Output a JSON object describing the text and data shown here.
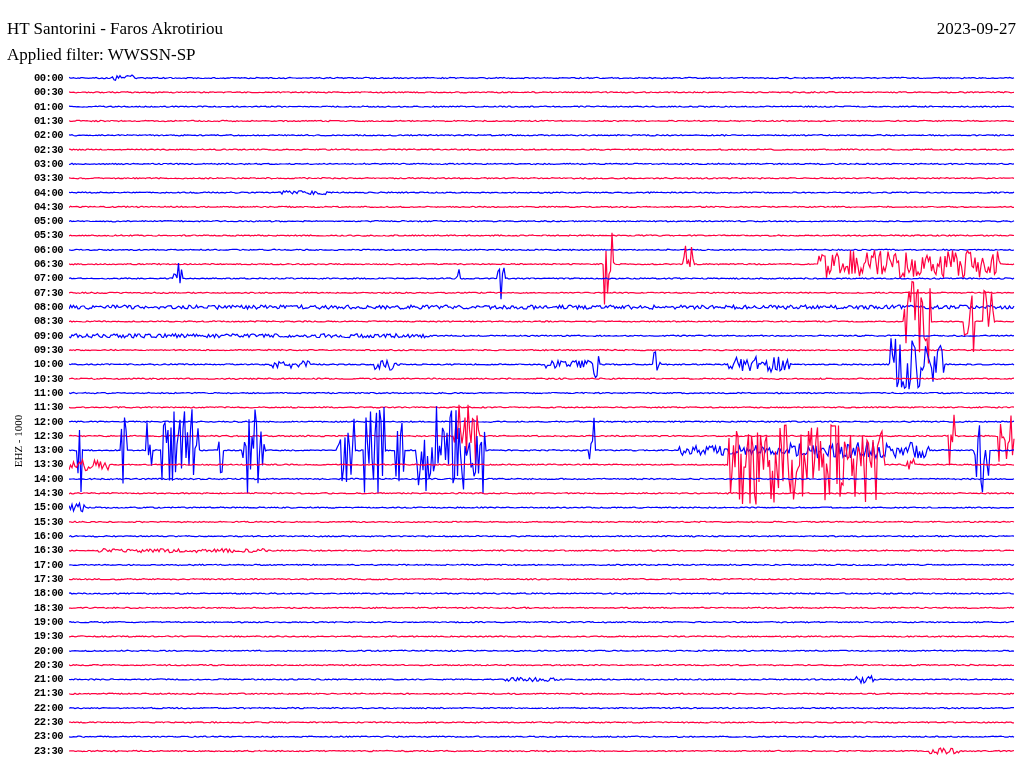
{
  "header": {
    "title": "HT Santorini - Faros Akrotiriou",
    "date": "2023-09-27",
    "filter": "Applied filter: WWSSN-SP"
  },
  "helicorder": {
    "channel_label": "EHZ - 1000",
    "rows": [
      {
        "time": "00:00",
        "color": "#0000ff"
      },
      {
        "time": "00:30",
        "color": "#ff0040"
      },
      {
        "time": "01:00",
        "color": "#0000ff"
      },
      {
        "time": "01:30",
        "color": "#ff0040"
      },
      {
        "time": "02:00",
        "color": "#0000ff"
      },
      {
        "time": "02:30",
        "color": "#ff0040"
      },
      {
        "time": "03:00",
        "color": "#0000ff"
      },
      {
        "time": "03:30",
        "color": "#ff0040"
      },
      {
        "time": "04:00",
        "color": "#0000ff"
      },
      {
        "time": "04:30",
        "color": "#ff0040"
      },
      {
        "time": "05:00",
        "color": "#0000ff"
      },
      {
        "time": "05:30",
        "color": "#ff0040"
      },
      {
        "time": "06:00",
        "color": "#0000ff"
      },
      {
        "time": "06:30",
        "color": "#ff0040"
      },
      {
        "time": "07:00",
        "color": "#0000ff"
      },
      {
        "time": "07:30",
        "color": "#ff0040"
      },
      {
        "time": "08:00",
        "color": "#0000ff"
      },
      {
        "time": "08:30",
        "color": "#ff0040"
      },
      {
        "time": "09:00",
        "color": "#0000ff"
      },
      {
        "time": "09:30",
        "color": "#ff0040"
      },
      {
        "time": "10:00",
        "color": "#0000ff"
      },
      {
        "time": "10:30",
        "color": "#ff0040"
      },
      {
        "time": "11:00",
        "color": "#0000ff"
      },
      {
        "time": "11:30",
        "color": "#ff0040"
      },
      {
        "time": "12:00",
        "color": "#0000ff"
      },
      {
        "time": "12:30",
        "color": "#ff0040"
      },
      {
        "time": "13:00",
        "color": "#0000ff"
      },
      {
        "time": "13:30",
        "color": "#ff0040"
      },
      {
        "time": "14:00",
        "color": "#0000ff"
      },
      {
        "time": "14:30",
        "color": "#ff0040"
      },
      {
        "time": "15:00",
        "color": "#0000ff"
      },
      {
        "time": "15:30",
        "color": "#ff0040"
      },
      {
        "time": "16:00",
        "color": "#0000ff"
      },
      {
        "time": "16:30",
        "color": "#ff0040"
      },
      {
        "time": "17:00",
        "color": "#0000ff"
      },
      {
        "time": "17:30",
        "color": "#ff0040"
      },
      {
        "time": "18:00",
        "color": "#0000ff"
      },
      {
        "time": "18:30",
        "color": "#ff0040"
      },
      {
        "time": "19:00",
        "color": "#0000ff"
      },
      {
        "time": "19:30",
        "color": "#ff0040"
      },
      {
        "time": "20:00",
        "color": "#0000ff"
      },
      {
        "time": "20:30",
        "color": "#ff0040"
      },
      {
        "time": "21:00",
        "color": "#0000ff"
      },
      {
        "time": "21:30",
        "color": "#ff0040"
      },
      {
        "time": "22:00",
        "color": "#0000ff"
      },
      {
        "time": "22:30",
        "color": "#ff0040"
      },
      {
        "time": "23:00",
        "color": "#0000ff"
      },
      {
        "time": "23:30",
        "color": "#ff0040"
      }
    ]
  }
}
